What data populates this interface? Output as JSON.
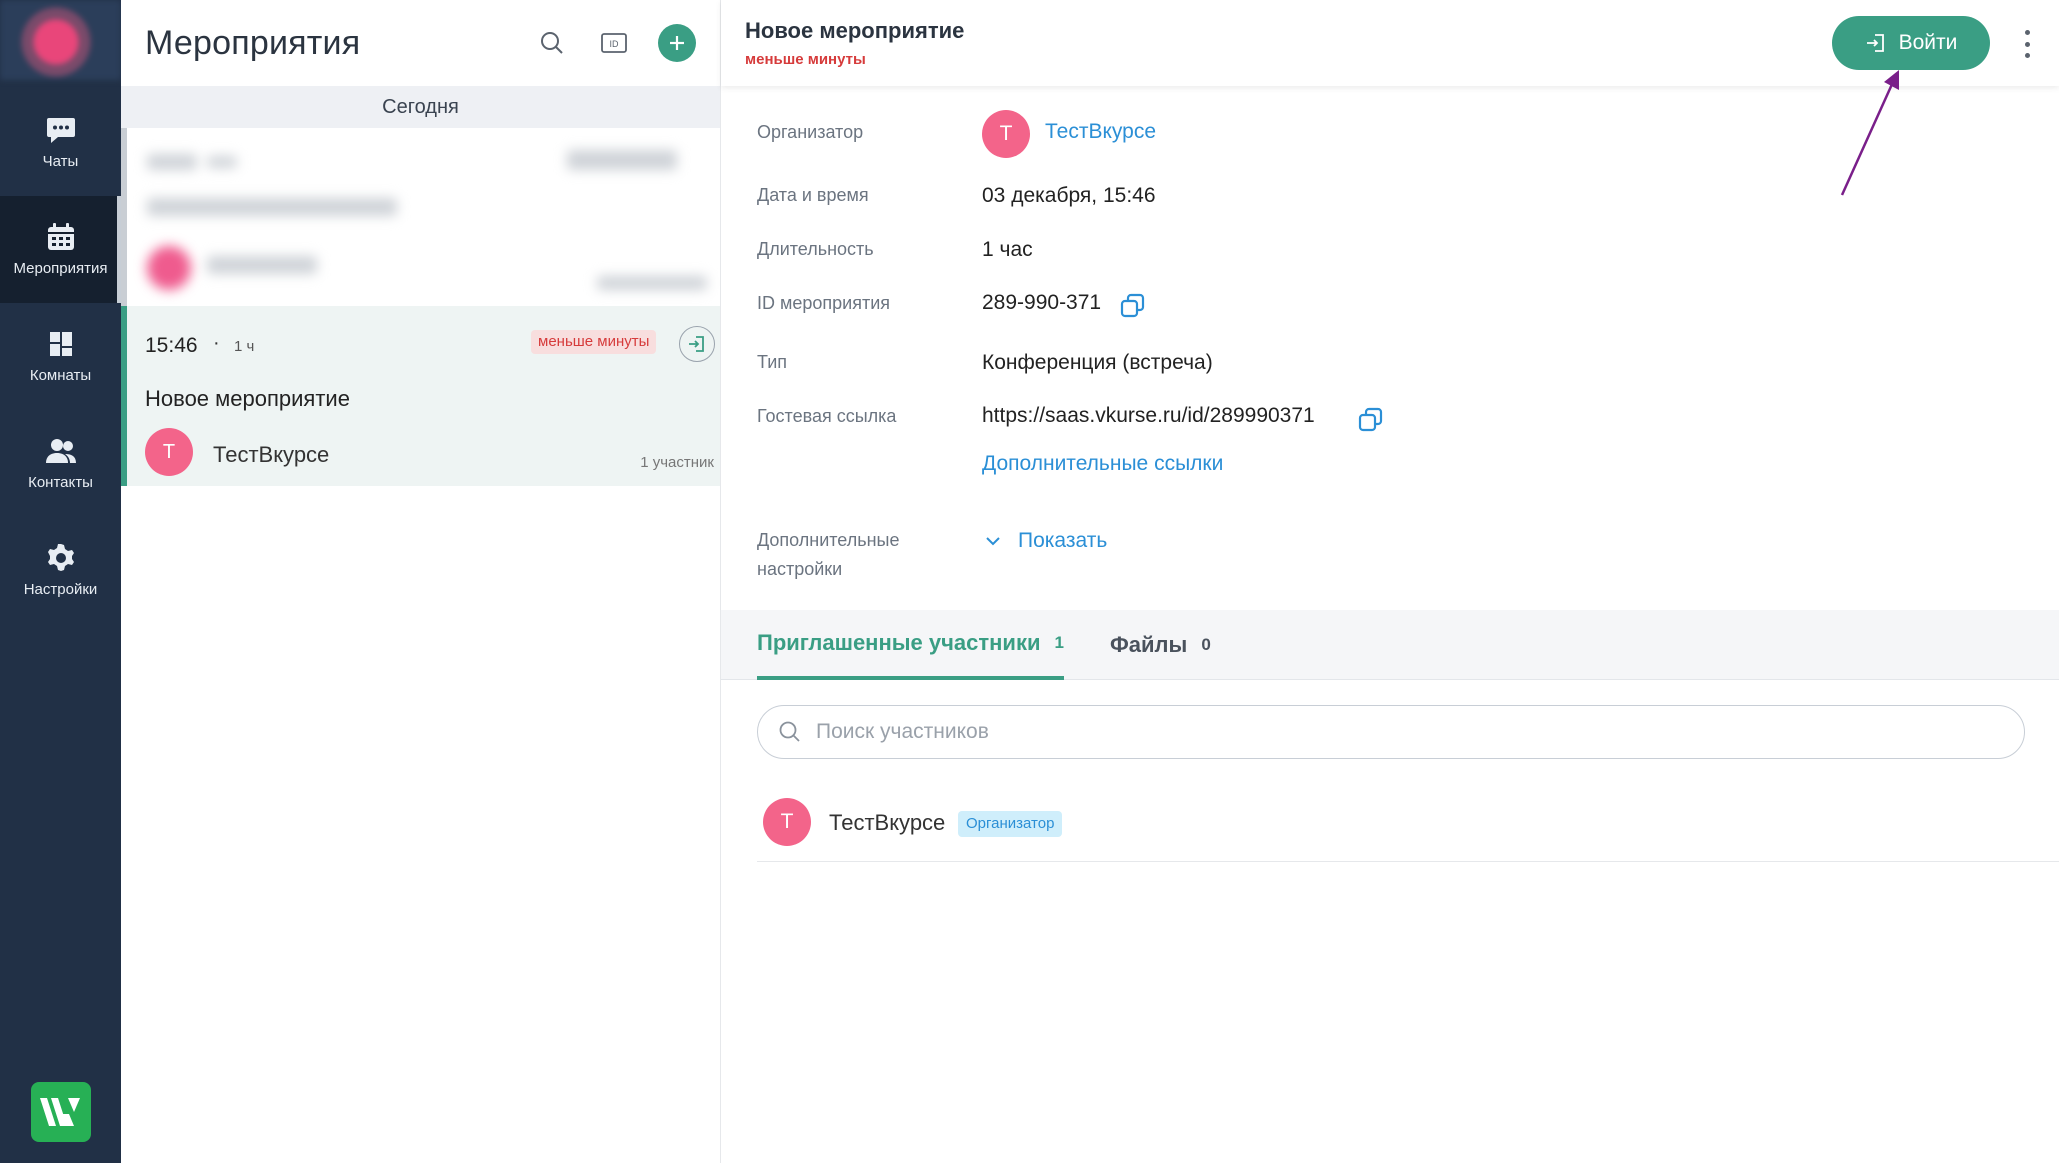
{
  "rail": {
    "items": [
      {
        "label": "Чаты",
        "icon": "chat-icon"
      },
      {
        "label": "Мероприятия",
        "icon": "calendar-icon"
      },
      {
        "label": "Комнаты",
        "icon": "rooms-icon"
      },
      {
        "label": "Контакты",
        "icon": "contacts-icon"
      },
      {
        "label": "Настройки",
        "icon": "gear-icon"
      }
    ],
    "active_index": 1
  },
  "list": {
    "title": "Мероприятия",
    "day_header": "Сегодня",
    "event": {
      "time": "15:46",
      "dot": "·",
      "duration": "1 ч",
      "status_badge": "меньше минуты",
      "name": "Новое мероприятие",
      "organizer_initial": "Т",
      "organizer_name": "ТестВкурсе",
      "participants": "1 участник"
    }
  },
  "detail": {
    "title": "Новое мероприятие",
    "subtitle": "меньше минуты",
    "enter_label": "Войти",
    "rows": {
      "organizer_label": "Организатор",
      "organizer_initial": "Т",
      "organizer_name": "ТестВкурсе",
      "datetime_label": "Дата и время",
      "datetime_value": "03 декабря, 15:46",
      "duration_label": "Длительность",
      "duration_value": "1 час",
      "id_label": "ID мероприятия",
      "id_value": "289-990-371",
      "type_label": "Тип",
      "type_value": "Конференция (встреча)",
      "guest_label": "Гостевая ссылка",
      "guest_value": "https://saas.vkurse.ru/id/289990371",
      "more_links": "Дополнительные ссылки",
      "settings_label_1": "Дополнительные",
      "settings_label_2": "настройки",
      "show_label": "Показать"
    },
    "tabs": [
      {
        "label": "Приглашенные участники",
        "count": "1"
      },
      {
        "label": "Файлы",
        "count": "0"
      }
    ],
    "search_placeholder": "Поиск участников",
    "participant": {
      "initial": "Т",
      "name": "ТестВкурсе",
      "role": "Организатор"
    }
  },
  "colors": {
    "rail": "#213046",
    "accent": "#3a9e84",
    "link": "#2b8fd6",
    "alert": "#d63b3b",
    "avatar": "#f3648a",
    "annotation_arrow": "#7a1f8a"
  }
}
